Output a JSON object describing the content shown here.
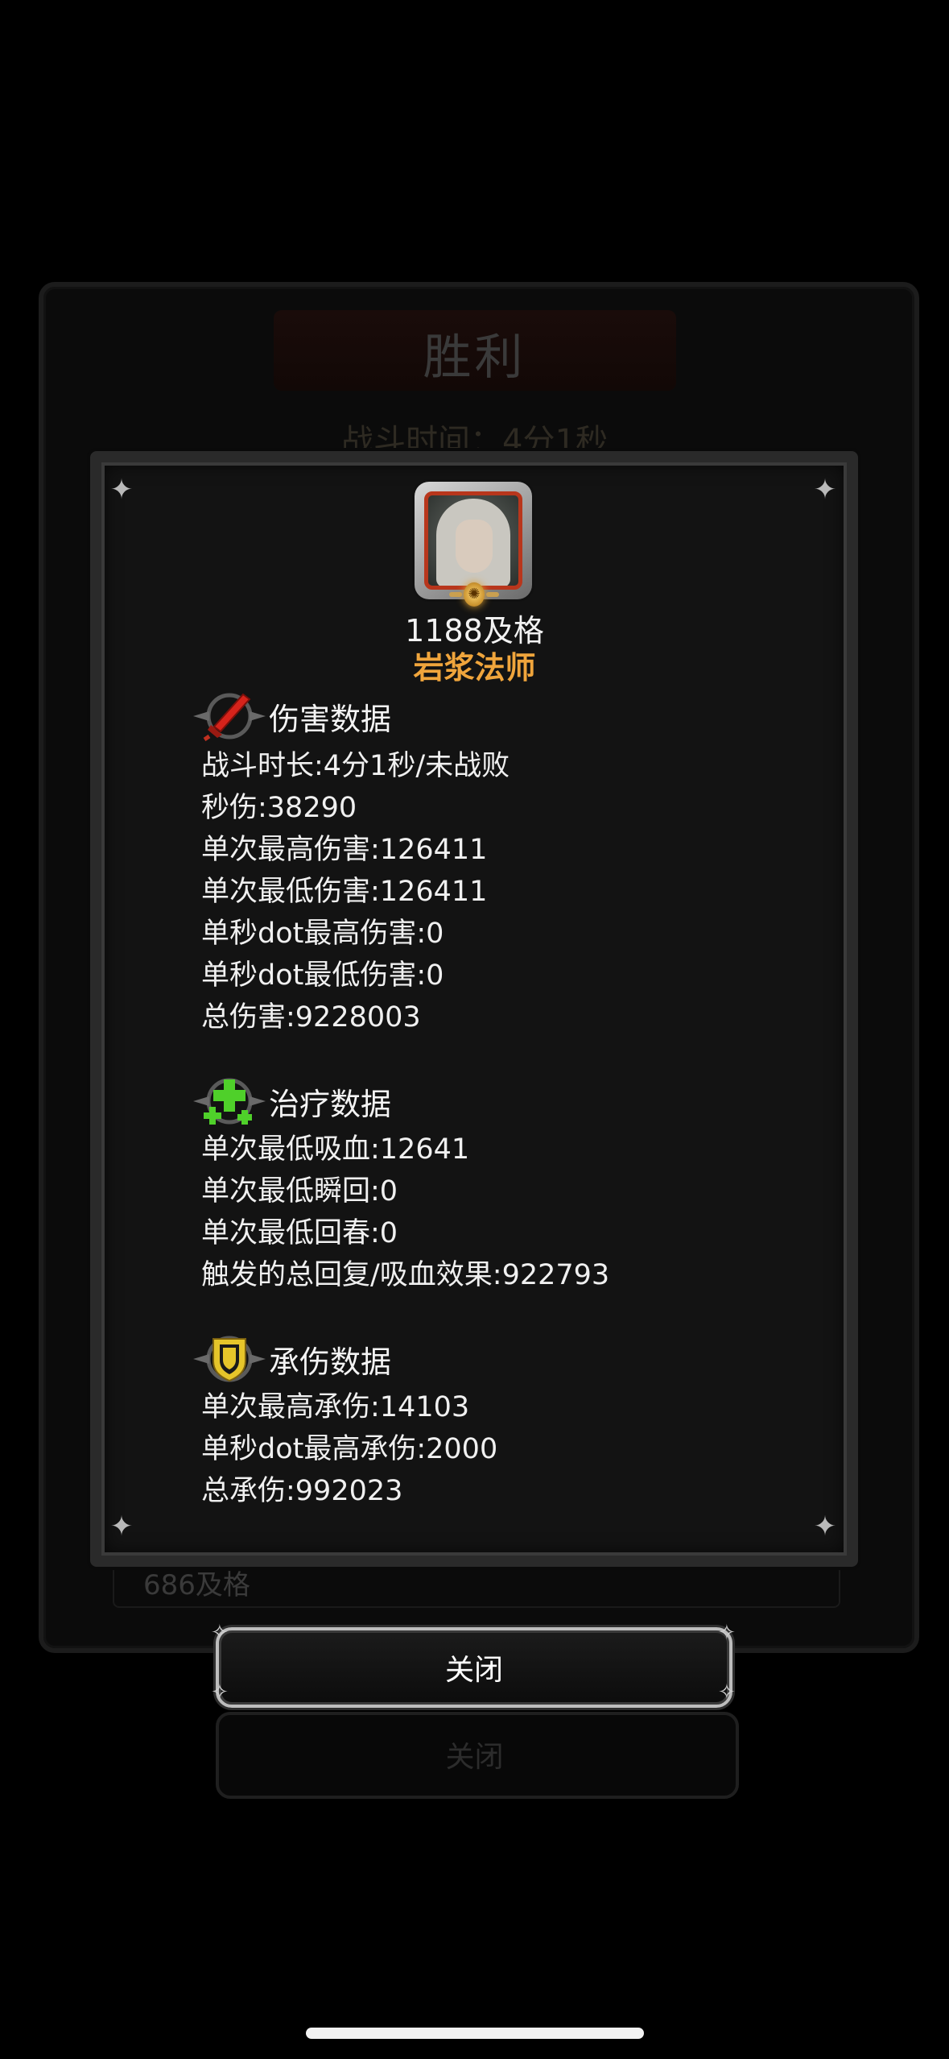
{
  "background_window": {
    "title": "胜利",
    "subtitle": "战斗时间：4分1秒",
    "row_label": "686及格",
    "close_label": "关闭"
  },
  "player": {
    "name": "1188及格",
    "class": "岩浆法师"
  },
  "sections": {
    "damage": {
      "title": "伤害数据",
      "icon": "red-sword-icon",
      "lines": [
        "战斗时长:4分1秒/未战败",
        "秒伤:38290",
        "单次最高伤害:126411",
        "单次最低伤害:126411",
        "单秒dot最高伤害:0",
        "单秒dot最低伤害:0",
        "总伤害:9228003"
      ]
    },
    "healing": {
      "title": "治疗数据",
      "icon": "green-cross-icon",
      "lines": [
        "单次最低吸血:12641",
        "单次最低瞬回:0",
        "单次最低回春:0",
        "触发的总回复/吸血效果:922793"
      ]
    },
    "tank": {
      "title": "承伤数据",
      "icon": "yellow-shield-icon",
      "lines": [
        "单次最高承伤:14103",
        "单秒dot最高承伤:2000",
        "总承伤:992023"
      ]
    }
  },
  "close_button": {
    "label": "关闭"
  },
  "colors": {
    "class_name": "#f0a53c",
    "portrait_border": "#b8361c",
    "heal_icon": "#4fd02a",
    "shield_icon": "#e6c52a",
    "sword_icon": "#d6231b"
  }
}
